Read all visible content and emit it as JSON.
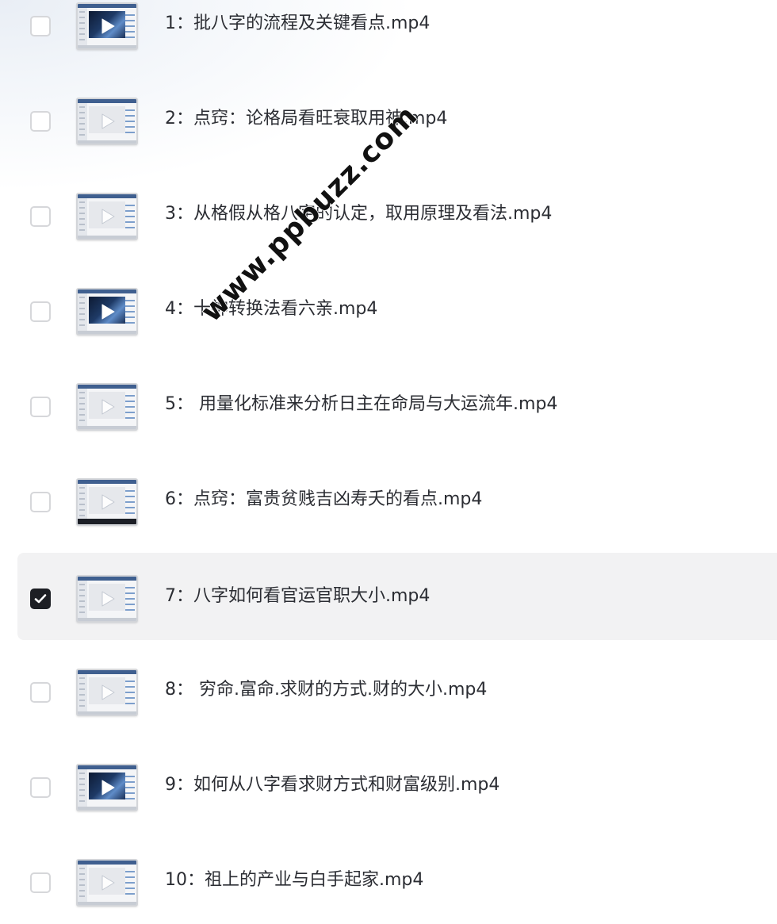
{
  "files": [
    {
      "label": "1：批八字的流程及关键看点.mp4",
      "checked": false,
      "thumb": "dark"
    },
    {
      "label": "2：点窍：论格局看旺衰取用神.mp4",
      "checked": false,
      "thumb": "light"
    },
    {
      "label": "3：从格假从格八字的认定，取用原理及看法.mp4",
      "checked": false,
      "thumb": "light"
    },
    {
      "label": "4：十神转换法看六亲.mp4",
      "checked": false,
      "thumb": "dark"
    },
    {
      "label": "5： 用量化标准来分析日主在命局与大运流年.mp4",
      "checked": false,
      "thumb": "light"
    },
    {
      "label": "6：点窍：富贵贫贱吉凶寿夭的看点.mp4",
      "checked": false,
      "thumb": "light-darkbottom"
    },
    {
      "label": "7：八字如何看官运官职大小.mp4",
      "checked": true,
      "thumb": "light"
    },
    {
      "label": "8： 穷命.富命.求财的方式.财的大小.mp4",
      "checked": false,
      "thumb": "light"
    },
    {
      "label": "9：如何从八字看求财方式和财富级别.mp4",
      "checked": false,
      "thumb": "dark"
    },
    {
      "label": "10：祖上的产业与白手起家.mp4",
      "checked": false,
      "thumb": "light"
    }
  ],
  "watermark": "www.ppbuzz.com",
  "colors": {
    "selected_row_bg": "#f2f2f3",
    "checkbox_checked": "#1d1f24",
    "text": "#2b2d33"
  }
}
